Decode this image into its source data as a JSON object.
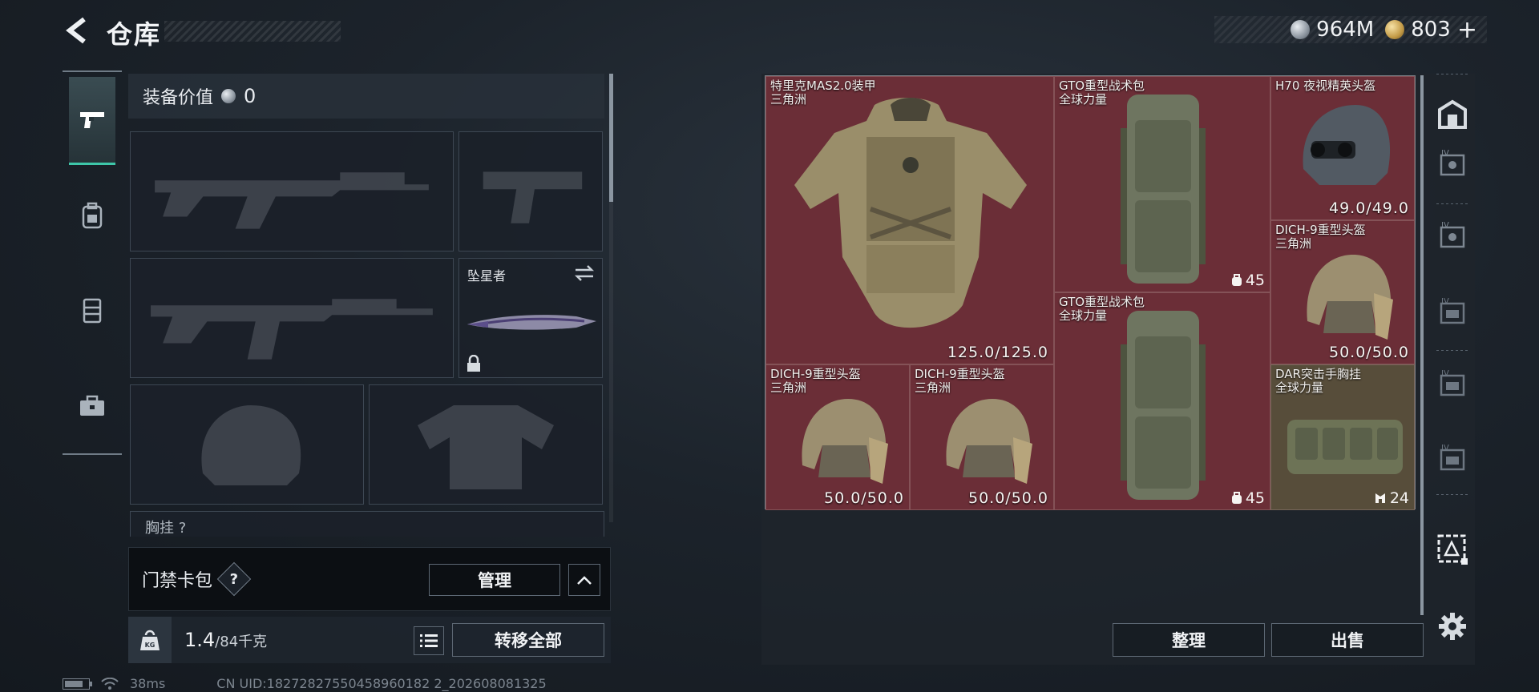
{
  "header": {
    "title": "仓库",
    "currency": [
      {
        "icon": "silver-coin-icon",
        "amount": "964M"
      },
      {
        "icon": "gold-coin-icon",
        "amount": "803"
      }
    ],
    "add_label": "+"
  },
  "equipment": {
    "value_label": "装备价值",
    "value": "0",
    "melee_slot_name": "坠星者",
    "chest_rig_label": "胸挂 ?"
  },
  "keycard": {
    "label": "门禁卡包",
    "help": "?",
    "manage_label": "管理"
  },
  "weight": {
    "current": "1.4",
    "max": "/84千克",
    "transfer_all_label": "转移全部"
  },
  "footer": {
    "ping": "38ms",
    "uid": "CN UID:18272827550458960182 2_202608081325"
  },
  "storage": {
    "items": [
      {
        "name": "特里克MAS2.0装甲",
        "sub": "三角洲",
        "durability": "125.0/125.0"
      },
      {
        "name": "GTO重型战术包",
        "sub": "全球力量",
        "count": "45"
      },
      {
        "name": "H70 夜视精英头盔",
        "sub": "",
        "durability": "49.0/49.0"
      },
      {
        "name": "DICH-9重型头盔",
        "sub": "三角洲",
        "durability": "50.0/50.0"
      },
      {
        "name": "GTO重型战术包",
        "sub": "全球力量",
        "count": "45"
      },
      {
        "name": "DICH-9重型头盔",
        "sub": "三角洲",
        "durability": "50.0/50.0"
      },
      {
        "name": "DICH-9重型头盔",
        "sub": "三角洲",
        "durability": "50.0/50.0"
      },
      {
        "name": "DAR突击手胸挂",
        "sub": "全球力量",
        "count": "24"
      }
    ],
    "sort_label": "整理",
    "sell_label": "出售"
  },
  "colors": {
    "accent": "#3ec7a9",
    "storage_cell": "#6b2e37"
  }
}
